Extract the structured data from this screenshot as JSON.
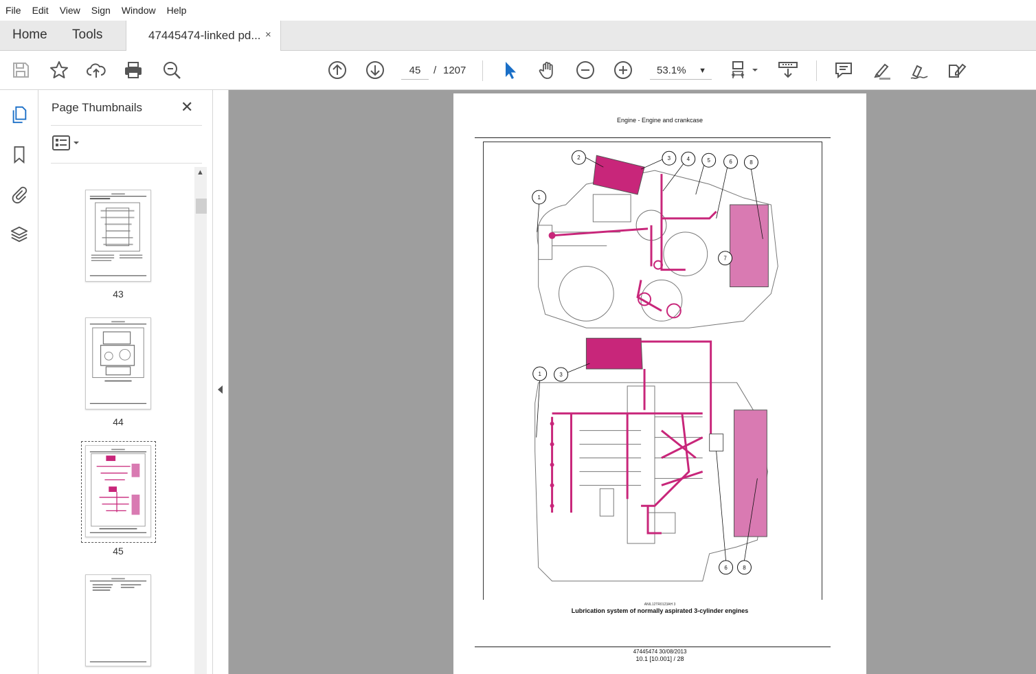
{
  "menu": [
    "File",
    "Edit",
    "View",
    "Sign",
    "Window",
    "Help"
  ],
  "tabs": {
    "home": "Home",
    "tools": "Tools",
    "document": "47445474-linked pd...",
    "close": "×"
  },
  "toolbar": {
    "page_current": "45",
    "page_sep": "/",
    "page_total": "1207",
    "zoom": "53.1%"
  },
  "sidebar": {
    "title": "Page Thumbnails",
    "close": "✕",
    "thumbnails": [
      {
        "label": "43"
      },
      {
        "label": "44"
      },
      {
        "label": "45",
        "selected": true
      },
      {
        "label": ""
      }
    ]
  },
  "document_page": {
    "header": "Engine - Engine and crankcase",
    "image_code": "ANIL12TR0123AH   3",
    "caption": "Lubrication system of normally aspirated 3-cylinder engines",
    "footer_line1": "47445474 30/08/2013",
    "footer_line2": "10.1 [10.001] / 28",
    "callouts_top": [
      "1",
      "2",
      "3",
      "4",
      "5",
      "6",
      "7",
      "8"
    ],
    "callouts_bottom": [
      "1",
      "3",
      "6",
      "8"
    ]
  },
  "colors": {
    "accent_blue": "#1a6fc7",
    "oil_magenta": "#c8267a",
    "canvas_gray": "#9e9e9e"
  }
}
